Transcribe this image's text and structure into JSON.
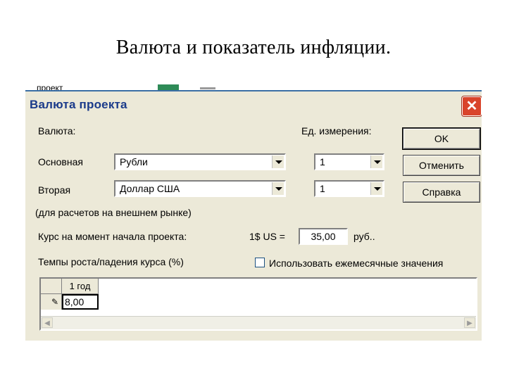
{
  "slide": {
    "title": "Валюта и показатель инфляции."
  },
  "background": {
    "fragment": "проект"
  },
  "dialog": {
    "title": "Валюта проекта",
    "close_glyph": "✕",
    "currency_label": "Валюта:",
    "unit_label": "Ед. измерения:",
    "primary": {
      "label": "Основная",
      "currency": "Рубли",
      "unit": "1"
    },
    "secondary": {
      "label": "Вторая",
      "currency": "Доллар США",
      "unit": "1"
    },
    "foreign_note": "(для расчетов на внешнем рынке)",
    "rate": {
      "label": "Курс на момент начала проекта:",
      "prefix": "1$ US =",
      "value": "35,00",
      "suffix": "руб.."
    },
    "growth_label": "Темпы роста/падения курса (%)",
    "monthly_checkbox": {
      "label": "Использовать ежемесячные значения",
      "checked": false
    },
    "buttons": {
      "ok": "OK",
      "cancel": "Отменить",
      "help": "Справка"
    },
    "grid": {
      "column": "1 год",
      "row_marker": "✎",
      "value": "8,00",
      "scroll_left": "◀",
      "scroll_right": "▶"
    }
  }
}
